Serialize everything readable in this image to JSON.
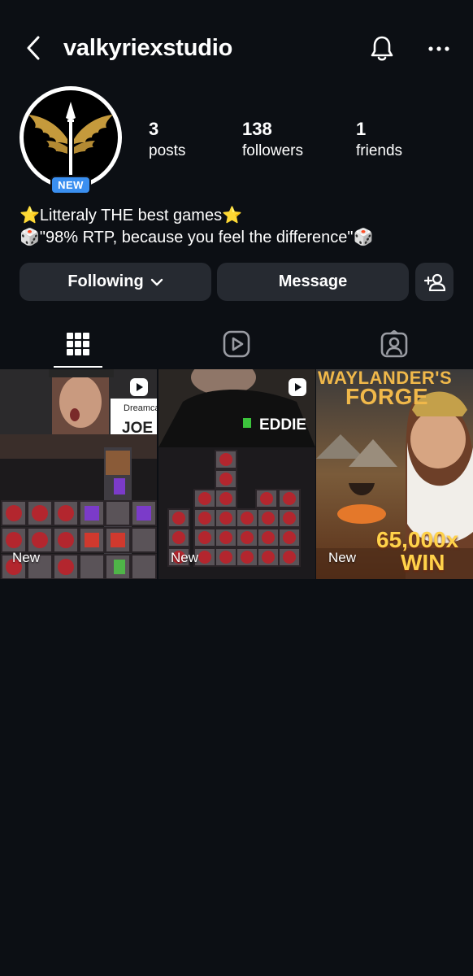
{
  "header": {
    "username": "valkyriexstudio",
    "back_icon": "chevron-left-icon",
    "bell_icon": "bell-icon",
    "more_icon": "more-horizontal-icon"
  },
  "profile": {
    "badge": "NEW",
    "stats": [
      {
        "value": "3",
        "label": "posts"
      },
      {
        "value": "138",
        "label": "followers"
      },
      {
        "value": "1",
        "label": "friends"
      }
    ],
    "bio": [
      "⭐Litteraly THE best games⭐",
      "🎲\"98% RTP, because you feel the difference\"🎲"
    ]
  },
  "actions": {
    "following_label": "Following",
    "message_label": "Message",
    "add_user_icon": "add-user-icon"
  },
  "tabs": [
    {
      "name": "grid",
      "icon": "grid-icon",
      "active": true
    },
    {
      "name": "reels",
      "icon": "reels-icon",
      "active": false
    },
    {
      "name": "tagged",
      "icon": "tagged-user-icon",
      "active": false
    }
  ],
  "posts": [
    {
      "label": "New",
      "overlay_text": "JOE",
      "overlay_brand": "Dreamcas",
      "reel": true
    },
    {
      "label": "New",
      "overlay_text": "EDDIE",
      "reel": true
    },
    {
      "label": "New",
      "title_line1": "WAYLANDER'S",
      "title_line2": "FORGE",
      "win_amount": "65,000x",
      "win_label": "WIN",
      "reel": false
    }
  ],
  "colors": {
    "background": "#0c0f14",
    "button": "#262a31",
    "badge": "#3a8ff0",
    "text": "#ffffff"
  }
}
